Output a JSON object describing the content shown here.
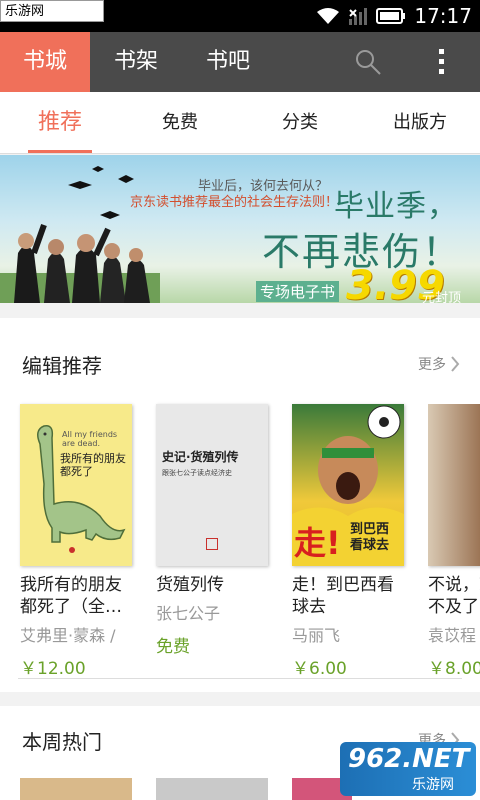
{
  "status": {
    "watermark": "乐游网 www.962.net",
    "time": "17:17"
  },
  "topbar": {
    "tabs": [
      "书城",
      "书架",
      "书吧"
    ],
    "active_color": "#f0705a"
  },
  "subtabs": [
    "推荐",
    "免费",
    "分类",
    "出版方"
  ],
  "banner": {
    "line1": "毕业后，该何去何从？",
    "line2": "京东读书推荐最全的社会生存法则！",
    "headline1": "毕业季，",
    "headline2": "不再悲伤！",
    "sub": "专场电子书",
    "price": "3.99",
    "unit": "元封顶"
  },
  "editor": {
    "title": "编辑推荐",
    "more": "更多",
    "books": [
      {
        "title": "我所有的朋友都死了（全…",
        "author": "艾弗里·蒙森 /",
        "price": "￥12.00",
        "cover_text": "All my friends are dead.",
        "cover_title": "我所有的朋友都死了"
      },
      {
        "title": "货殖列传",
        "author": "张七公子",
        "price": "免费",
        "cover_text": "史记·货殖列传",
        "cover_sub": "跟张七公子读点经济史"
      },
      {
        "title": "走！到巴西看球去",
        "author": "马丽飞",
        "price": "￥6.00",
        "cover_text": "到巴西看球去",
        "cover_big": "走!"
      },
      {
        "title": "不说，就来不及了",
        "author": "袁苡程",
        "price": "￥8.00"
      }
    ]
  },
  "weekly": {
    "title": "本周热门",
    "more": "更多"
  },
  "watermark2": {
    "brand": "962.NET",
    "sub": "乐游网"
  }
}
